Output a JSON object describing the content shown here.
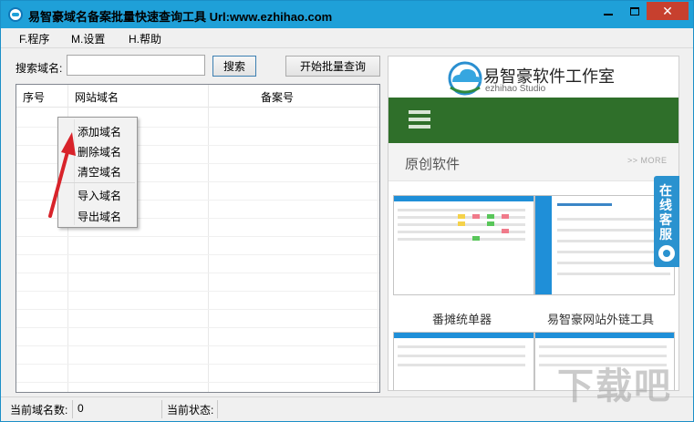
{
  "window": {
    "title": "易智豪域名备案批量快速查询工具 Url:www.ezhihao.com",
    "close_glyph": "✕"
  },
  "menu": {
    "items": [
      {
        "label": "F.程序"
      },
      {
        "label": "M.设置"
      },
      {
        "label": "H.帮助"
      }
    ]
  },
  "search": {
    "label": "搜索域名:",
    "value": "",
    "placeholder": "",
    "search_button": "搜索",
    "batch_button": "开始批量查询"
  },
  "table": {
    "columns": [
      "序号",
      "网站域名",
      "备案号"
    ],
    "rows": []
  },
  "context_menu": {
    "items": [
      {
        "label": "添加域名"
      },
      {
        "label": "删除域名"
      },
      {
        "label": "清空域名"
      },
      {
        "label": "导入域名"
      },
      {
        "label": "导出域名"
      }
    ]
  },
  "status": {
    "count_label": "当前域名数:",
    "count_value": "0",
    "state_label": "当前状态:",
    "state_value": ""
  },
  "browser": {
    "logo_text": "易智豪软件工作室",
    "logo_sub": "ezhihao Studio",
    "section_title": "原创软件",
    "section_more": ">> MORE",
    "captions": [
      "番摊统单器",
      "易智豪网站外链工具"
    ],
    "cs_widget": "在线客服"
  },
  "watermark": "下载吧",
  "colors": {
    "titlebar": "#1fa0d8",
    "close_button": "#c7402e",
    "navbar": "#2f6f2a",
    "arrow": "#d8232a"
  }
}
